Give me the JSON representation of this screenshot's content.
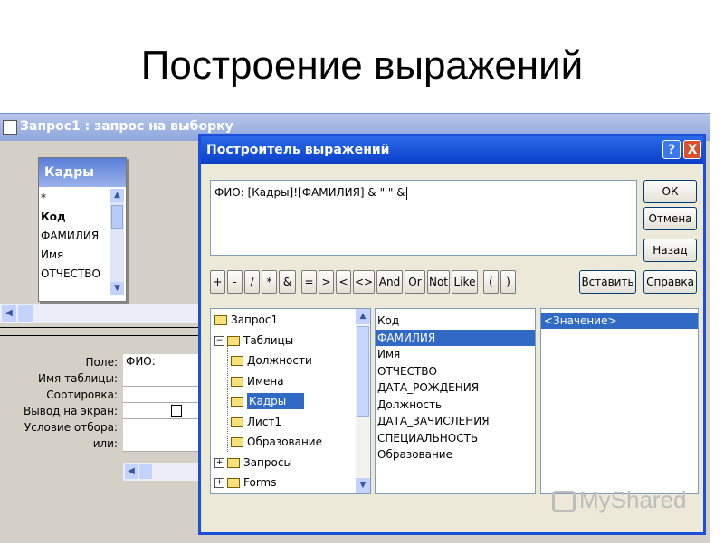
{
  "slide": {
    "title": "Построение выражений"
  },
  "bg_window": {
    "title": "Запрос1 : запрос на выборку",
    "table": {
      "name": "Кадры",
      "fields": [
        "*",
        "Код",
        "ФАМИЛИЯ",
        "Имя",
        "ОТЧЕСТВО"
      ]
    },
    "grid": {
      "labels": [
        "Поле:",
        "Имя таблицы:",
        "Сортировка:",
        "Вывод на экран:",
        "Условие отбора:",
        "или:"
      ],
      "field_value": "ФИО:"
    }
  },
  "dialog": {
    "title": "Построитель выражений",
    "help_glyph": "?",
    "close_glyph": "X",
    "expression": "ФИО: [Кадры]![ФАМИЛИЯ] & \" \" &",
    "buttons": {
      "ok": "ОК",
      "cancel": "Отмена",
      "undo": "Назад",
      "paste": "Вставить",
      "help": "Справка"
    },
    "operators": [
      "+",
      "-",
      "/",
      "*",
      "&",
      "=",
      ">",
      "<",
      "<>",
      "And",
      "Or",
      "Not",
      "Like",
      "(",
      ")"
    ],
    "tree": {
      "items": [
        {
          "label": "Запрос1",
          "type": "folder"
        },
        {
          "label": "Таблицы",
          "type": "folder-open",
          "expander": "−"
        },
        {
          "label": "Должности",
          "type": "folder"
        },
        {
          "label": "Имена",
          "type": "folder"
        },
        {
          "label": "Кадры",
          "type": "folder-open"
        },
        {
          "label": "Лист1",
          "type": "folder"
        },
        {
          "label": "Образование",
          "type": "folder"
        },
        {
          "label": "Запросы",
          "type": "folder",
          "expander": "+"
        },
        {
          "label": "Forms",
          "type": "folder",
          "expander": "+"
        }
      ],
      "selected_index": 4
    },
    "fields": {
      "items": [
        "Код",
        "ФАМИЛИЯ",
        "Имя",
        "ОТЧЕСТВО",
        "ДАТА_РОЖДЕНИЯ",
        "Должность",
        "ДАТА_ЗАЧИСЛЕНИЯ",
        "СПЕЦИАЛЬНОСТЬ",
        "Образование"
      ],
      "selected_index": 1
    },
    "values": {
      "items": [
        "<Значение>"
      ],
      "selected_index": 0
    }
  },
  "watermark": {
    "text": "MyShared"
  },
  "colors": {
    "titlebar": "#0a40c8",
    "selection": "#316ac5",
    "dialog_bg": "#ece9d8",
    "window_bg": "#d4d0c8"
  }
}
